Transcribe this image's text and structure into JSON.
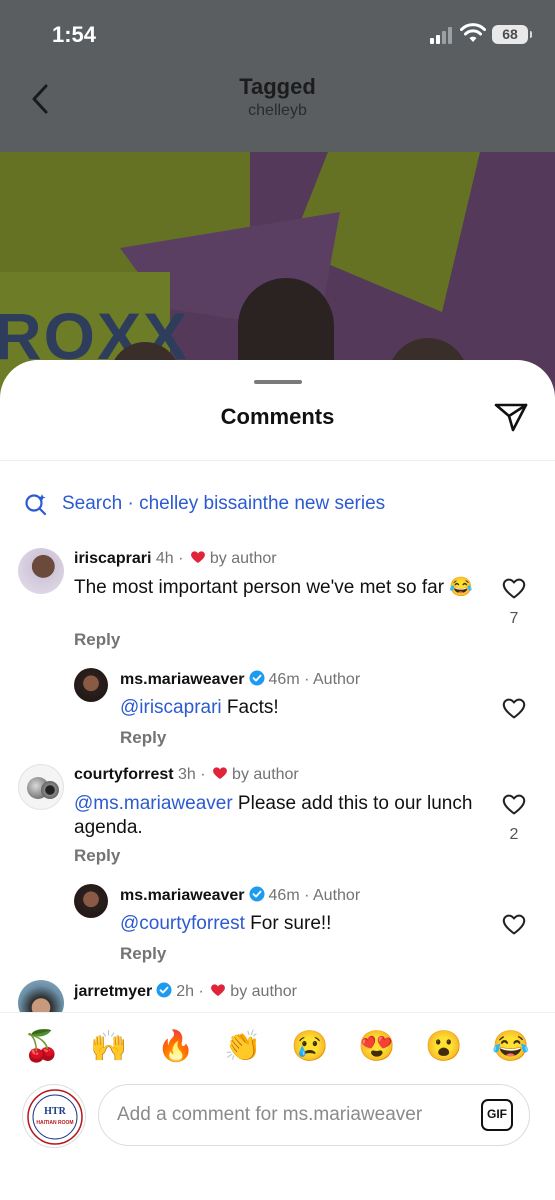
{
  "status_bar": {
    "time": "1:54",
    "battery": "68"
  },
  "nav": {
    "title": "Tagged",
    "subtitle": "chelleyb"
  },
  "post": {
    "banner_text": "ROXX"
  },
  "sheet": {
    "title": "Comments"
  },
  "search": {
    "label": "Search",
    "separator": "·",
    "query": "chelley bissainthe new series"
  },
  "comments": [
    {
      "username": "iriscaprari",
      "time": "4h",
      "liked_by": "by author",
      "text": "The most important person we've met so far 😂",
      "reply_label": "Reply",
      "likes": "7",
      "reply": {
        "username": "ms.mariaweaver",
        "time": "46m",
        "role": "Author",
        "mention": "@iriscaprari",
        "text": " Facts!",
        "reply_label": "Reply"
      }
    },
    {
      "username": "courtyforrest",
      "time": "3h",
      "liked_by": "by author",
      "mention": "@ms.mariaweaver",
      "text": " Please add this to our lunch agenda.",
      "reply_label": "Reply",
      "likes": "2",
      "reply": {
        "username": "ms.mariaweaver",
        "time": "46m",
        "role": "Author",
        "mention": "@courtyforrest",
        "text": " For sure!!",
        "reply_label": "Reply"
      }
    },
    {
      "username": "jarretmyer",
      "time": "2h",
      "liked_by": "by author"
    }
  ],
  "emojis": [
    "🍒",
    "🙌",
    "🔥",
    "👏",
    "😢",
    "😍",
    "😮",
    "😂"
  ],
  "composer": {
    "placeholder": "Add a comment for ms.mariaweaver",
    "gif_label": "GIF",
    "avatar_text_top": "HTR",
    "avatar_text_mid": "HAITIAN ROOM"
  },
  "colors": {
    "link": "#2c5ad1",
    "heart": "#e0243a",
    "verified": "#1d9bf0",
    "muted": "#737373"
  },
  "icons": [
    "back-icon",
    "signal-icon",
    "wifi-icon",
    "share-icon",
    "search-icon",
    "heart-icon",
    "verified-icon",
    "gif-icon"
  ]
}
